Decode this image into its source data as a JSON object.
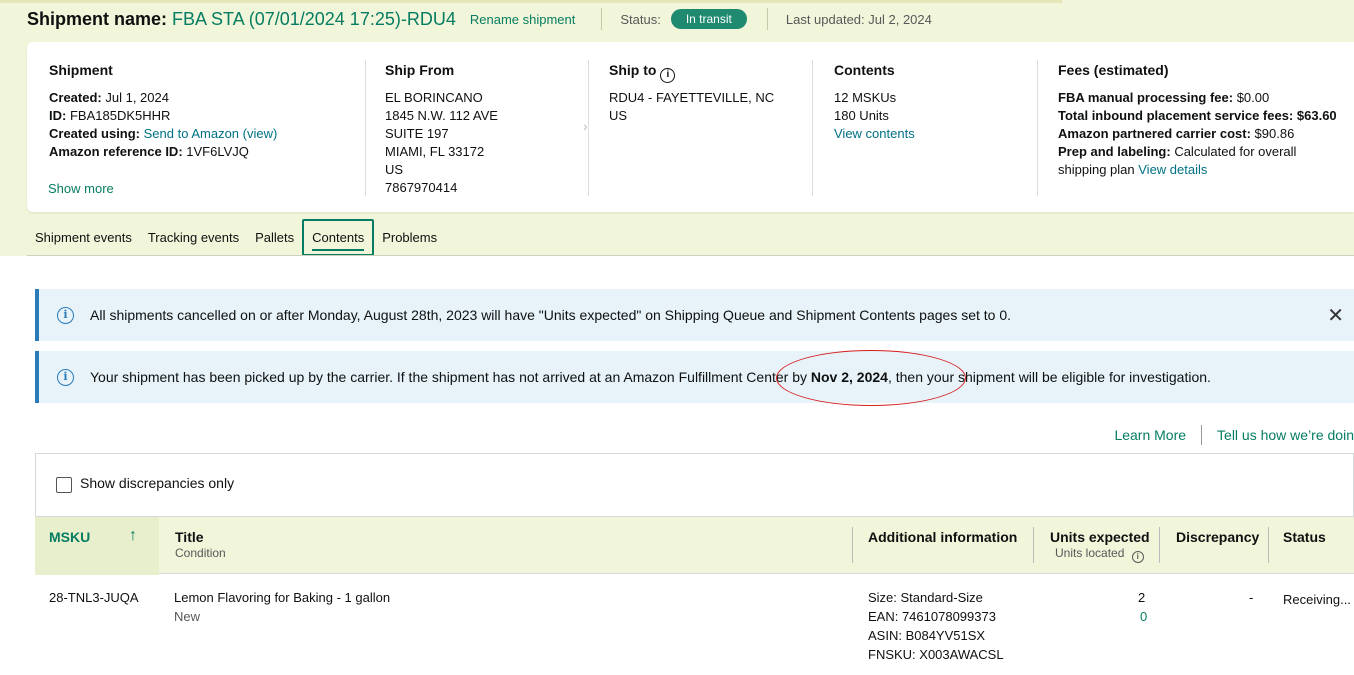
{
  "header": {
    "title_label": "Shipment name:",
    "title_value": "FBA STA (07/01/2024 17:25)-RDU4",
    "rename": "Rename shipment",
    "status_label": "Status:",
    "status_value": "In transit",
    "last_updated": "Last updated: Jul 2, 2024"
  },
  "shipment": {
    "heading": "Shipment",
    "created_label": "Created:",
    "created_value": "Jul 1, 2024",
    "id_label": "ID:",
    "id_value": "FBA185DK5HHR",
    "created_using_label": "Created using:",
    "created_using_value": "Send to Amazon (view)",
    "ref_label": "Amazon reference ID:",
    "ref_value": "1VF6LVJQ",
    "show_more": "Show more"
  },
  "ship_from": {
    "heading": "Ship From",
    "lines": [
      "EL BORINCANO",
      "1845 N.W. 112 AVE",
      "SUITE 197",
      "MIAMI, FL 33172",
      "US",
      "7867970414"
    ]
  },
  "ship_to": {
    "heading": "Ship to",
    "lines": [
      "RDU4 - FAYETTEVILLE, NC",
      "US"
    ]
  },
  "contents": {
    "heading": "Contents",
    "mskus": "12 MSKUs",
    "units": "180 Units",
    "view": "View contents"
  },
  "fees": {
    "heading": "Fees (estimated)",
    "manual_label": "FBA manual processing fee:",
    "manual_value": "$0.00",
    "placement_label": "Total inbound placement service fees:",
    "placement_value": "$63.60",
    "carrier_label": "Amazon partnered carrier cost:",
    "carrier_value": "$90.86",
    "prep_label": "Prep and labeling:",
    "prep_value": "Calculated for overall",
    "prep_value2": "shipping plan",
    "view_details": "View details"
  },
  "tabs": [
    "Shipment events",
    "Tracking events",
    "Pallets",
    "Contents",
    "Problems"
  ],
  "alerts": {
    "first": "All shipments cancelled on or after Monday, August 28th, 2023 will have \"Units expected\" on Shipping Queue and Shipment Contents pages set to 0.",
    "second_pre": "Your shipment has been picked up by the carrier. If the shipment has not arrived at an Amazon Fulfillment Center by ",
    "second_date": "Nov 2, 2024",
    "second_post": ", then your shipment will be eligible for investigation."
  },
  "links": {
    "learn_more": "Learn More",
    "tell_us": "Tell us how we’re doin"
  },
  "filter": {
    "show_discrepancies": "Show discrepancies only"
  },
  "table": {
    "headers": {
      "msku": "MSKU",
      "title": "Title",
      "condition": "Condition",
      "additional": "Additional information",
      "units_expected": "Units expected",
      "units_located": "Units located",
      "discrepancy": "Discrepancy",
      "status": "Status"
    },
    "rows": [
      {
        "msku": "28-TNL3-JUQA",
        "title": "Lemon Flavoring for Baking - 1 gallon",
        "condition": "New",
        "size": "Size: Standard-Size",
        "ean": "EAN: 7461078099373",
        "asin": "ASIN: B084YV51SX",
        "fnsku": "FNSKU: X003AWACSL",
        "units_expected": "2",
        "units_located": "0",
        "discrepancy": "-",
        "status": "Receiving..."
      }
    ]
  },
  "colors": {
    "band": "#f1f5d9",
    "accent": "#067d62",
    "status_pill": "#1f8a70",
    "alert_bg": "#e7f3f8",
    "alert_border": "#2b7bb9",
    "annotation": "#d61f1f"
  },
  "icons": {
    "info": "info-icon",
    "close": "close-icon",
    "sort": "arrow-up-icon",
    "chevron": "chevron-right-icon"
  }
}
